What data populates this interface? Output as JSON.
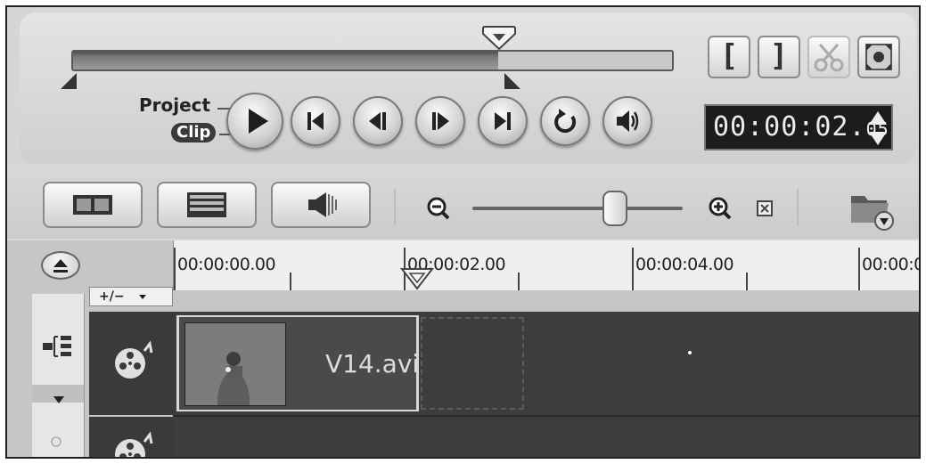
{
  "player": {
    "mode_project_label": "Project",
    "mode_clip_label": "Clip",
    "scrubber_position": 0.71,
    "timecode": {
      "main": "00:00:02.",
      "frames": "05"
    },
    "mark_in_label": "[",
    "mark_out_label": "]"
  },
  "timeline": {
    "ruler_labels": [
      "00:00:00.00",
      "00:00:02.00",
      "00:00:04.00",
      "00:00:0"
    ],
    "add_remove_label": "+/−",
    "clip_name": "V14.avi"
  },
  "icons": {
    "play": "play-icon",
    "home": "go-to-start-icon",
    "prev_frame": "previous-frame-icon",
    "next_frame": "next-frame-icon",
    "end": "go-to-end-icon",
    "repeat": "repeat-icon",
    "volume": "volume-icon",
    "cut": "scissors-icon",
    "fullscreen": "enlarge-preview-icon",
    "storyboard": "storyboard-view-icon",
    "timeline": "timeline-view-icon",
    "audio": "audio-view-icon",
    "zoom_out": "zoom-out-icon",
    "zoom_in": "zoom-in-icon",
    "fit": "fit-project-icon",
    "import": "import-folder-icon",
    "eject": "eject-icon",
    "video_track": "film-reel-icon",
    "track_manager": "track-manager-icon"
  },
  "colors": {
    "timecode_bg": "#1c1c1c",
    "track_bg": "#3d3d3d"
  }
}
